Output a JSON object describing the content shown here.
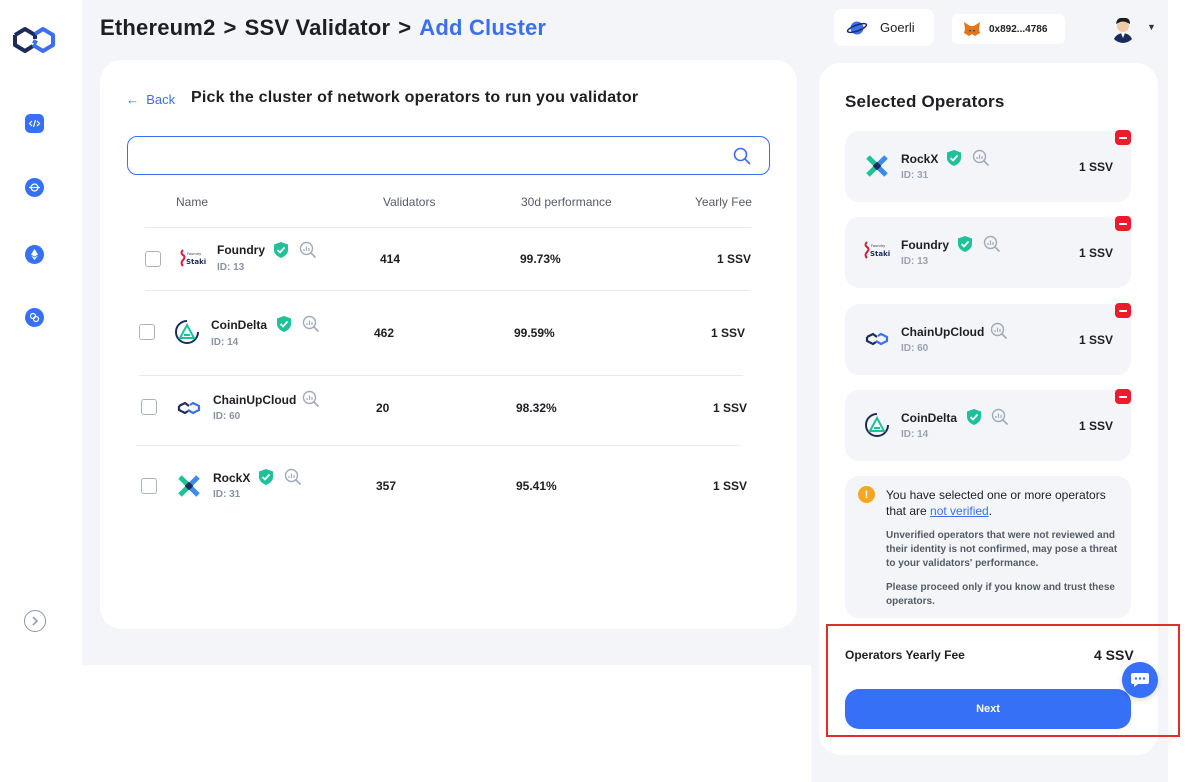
{
  "breadcrumb": {
    "part1": "Ethereum2",
    "sep1": ">",
    "part2": "SSV Validator",
    "sep2": ">",
    "part3": "Add Cluster"
  },
  "header": {
    "network": "Goerli",
    "wallet": "0x892...4786"
  },
  "left_card": {
    "back_label": "Back",
    "title": "Pick the cluster of network operators to run you validator",
    "search_placeholder": "",
    "columns": {
      "name": "Name",
      "validators": "Validators",
      "performance": "30d performance",
      "fee": "Yearly Fee"
    },
    "operators": [
      {
        "name": "Foundry",
        "id": "ID: 13",
        "validators": "414",
        "performance": "99.73%",
        "fee": "1 SSV",
        "logo": "foundry-staking-logo"
      },
      {
        "name": "CoinDelta",
        "id": "ID: 14",
        "validators": "462",
        "performance": "99.59%",
        "fee": "1 SSV",
        "logo": "coindelta-logo"
      },
      {
        "name": "ChainUpCloud",
        "id": "ID: 60",
        "validators": "20",
        "performance": "98.32%",
        "fee": "1 SSV",
        "logo": "chainupcloud-logo"
      },
      {
        "name": "RockX",
        "id": "ID: 31",
        "validators": "357",
        "performance": "95.41%",
        "fee": "1 SSV",
        "logo": "rockx-logo"
      }
    ]
  },
  "right_card": {
    "title": "Selected Operators",
    "selected": [
      {
        "name": "RockX",
        "id": "ID: 31",
        "fee": "1 SSV"
      },
      {
        "name": "Foundry",
        "id": "ID: 13",
        "fee": "1 SSV"
      },
      {
        "name": "ChainUpCloud",
        "id": "ID: 60",
        "fee": "1 SSV"
      },
      {
        "name": "CoinDelta",
        "id": "ID: 14",
        "fee": "1 SSV"
      }
    ],
    "warning": {
      "icon": "!",
      "head_prefix": "You have selected one or more operators that are ",
      "head_link": "not verified",
      "head_suffix": ".",
      "p1": "Unverified operators that were not reviewed and their identity is not confirmed, may pose a threat to your validators' performance.",
      "p2": "Please proceed only if you know and trust these operators."
    },
    "fee_label": "Operators Yearly Fee",
    "fee_value": "4 SSV",
    "next_label": "Next"
  },
  "logo_text": {
    "foundry_small": "Foundry",
    "foundry_big": "Staking"
  },
  "colors": {
    "accent": "#3670f6",
    "verified": "#1ec198",
    "remove": "#ec1c2e",
    "warning": "#f5a623",
    "highlight_border": "#e02d2d"
  }
}
